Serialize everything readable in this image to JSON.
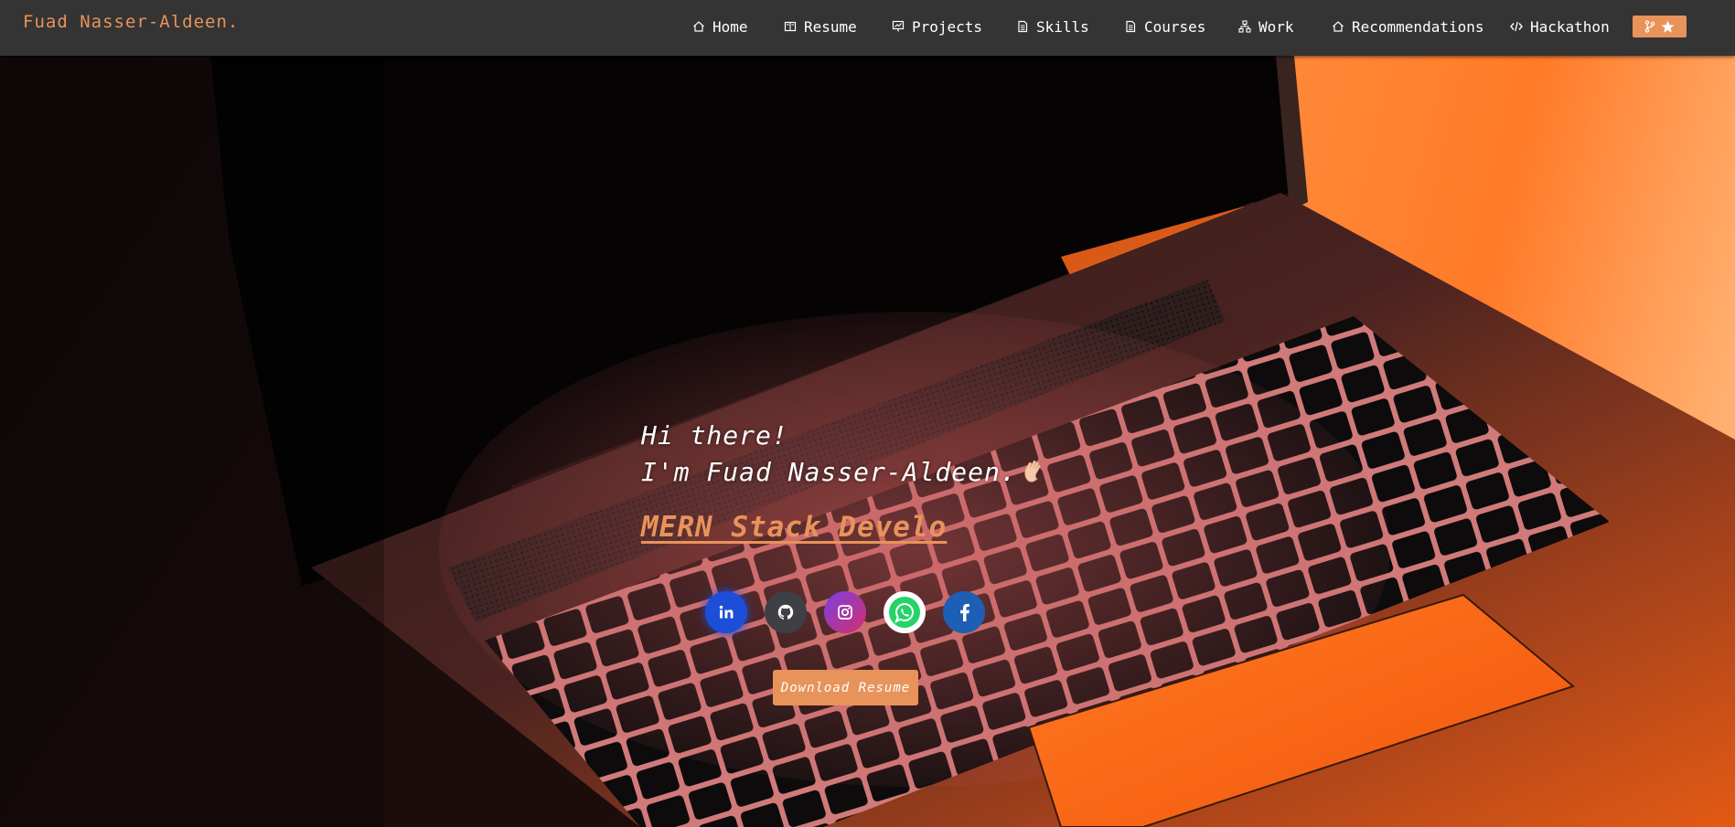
{
  "brand": {
    "name": "Fuad Nasser-Aldeen."
  },
  "nav": {
    "items": [
      {
        "label": "Home",
        "icon": "home-icon"
      },
      {
        "label": "Resume",
        "icon": "book-icon"
      },
      {
        "label": "Projects",
        "icon": "presentation-icon"
      },
      {
        "label": "Skills",
        "icon": "document-icon"
      },
      {
        "label": "Courses",
        "icon": "document-icon"
      },
      {
        "label": "Work",
        "icon": "sitemap-icon"
      },
      {
        "label": "Recommendations",
        "icon": "home-icon"
      },
      {
        "label": "Hackathon",
        "icon": "code-icon"
      }
    ],
    "github_button": {
      "icons": [
        "git-fork-icon",
        "star-icon"
      ]
    }
  },
  "hero": {
    "greeting_line1": "Hi there!",
    "greeting_line2": "I'm Fuad Nasser-Aldeen.",
    "greeting_emoji": "waving-hand-icon",
    "role": "MERN Stack Develo",
    "socials": [
      {
        "name": "linkedin",
        "icon": "linkedin-icon",
        "color": "#1d4ed8"
      },
      {
        "name": "github",
        "icon": "github-icon",
        "color": "#3f3f46"
      },
      {
        "name": "instagram",
        "icon": "instagram-icon",
        "color": "#c0347f"
      },
      {
        "name": "whatsapp",
        "icon": "whatsapp-icon",
        "color": "#25d366"
      },
      {
        "name": "facebook",
        "icon": "facebook-icon",
        "color": "#1d5fb4"
      }
    ],
    "download_label": "Download Resume"
  },
  "colors": {
    "accent": "#e8935a",
    "navbar": "#343434",
    "text": "#ffffff"
  }
}
